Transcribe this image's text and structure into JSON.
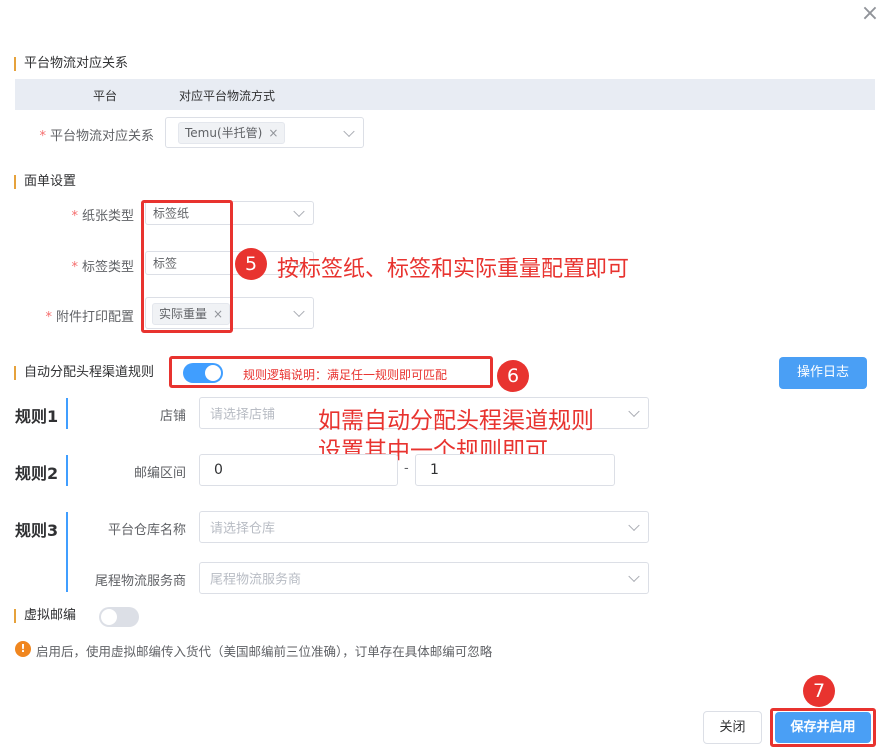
{
  "dialog": {
    "close_icon": "×"
  },
  "section_platform": {
    "title": "平台物流对应关系",
    "table_headers": [
      "平台",
      "对应平台物流方式"
    ],
    "field_label": "平台物流对应关系",
    "tags": [
      {
        "text": "Temu(半托管)",
        "remove": "×"
      }
    ]
  },
  "section_waybill": {
    "title": "面单设置",
    "paper_type": {
      "label": "纸张类型",
      "value": "标签纸"
    },
    "label_type": {
      "label": "标签类型",
      "value": "标签"
    },
    "attachment": {
      "label": "附件打印配置",
      "tags": [
        {
          "text": "实际重量",
          "remove": "×"
        }
      ]
    }
  },
  "annotations": {
    "badge5": "5",
    "text5": "按标签纸、标签和实际重量配置即可",
    "badge6": "6",
    "text6_line1": "如需自动分配头程渠道规则",
    "text6_line2": "设置其中一个规则即可",
    "badge7": "7"
  },
  "section_auto": {
    "title": "自动分配头程渠道规则",
    "toggle_on": true,
    "hint": "规则逻辑说明：满足任一规则即可匹配",
    "log_button": "操作日志",
    "rules": [
      {
        "label": "规则1",
        "fields": [
          {
            "label": "店铺",
            "placeholder": "请选择店铺"
          }
        ]
      },
      {
        "label": "规则2",
        "fields": [
          {
            "label": "邮编区间",
            "from": "0",
            "separator": "-",
            "to": "1"
          }
        ]
      },
      {
        "label": "规则3",
        "fields": [
          {
            "label": "平台仓库名称",
            "placeholder": "请选择仓库"
          },
          {
            "label": "尾程物流服务商",
            "placeholder": "尾程物流服务商"
          }
        ]
      }
    ]
  },
  "section_virtual": {
    "title": "虚拟邮编",
    "toggle_on": false,
    "info_icon": "!",
    "note": "启用后，使用虚拟邮编传入货代（美国邮编前三位准确），订单存在具体邮编可忽略"
  },
  "footer": {
    "close_button": "关闭",
    "save_button": "保存并启用"
  },
  "colors": {
    "accent": "#409eff",
    "annotation_red": "#e8332f",
    "section_marker": "#e6a23c"
  }
}
